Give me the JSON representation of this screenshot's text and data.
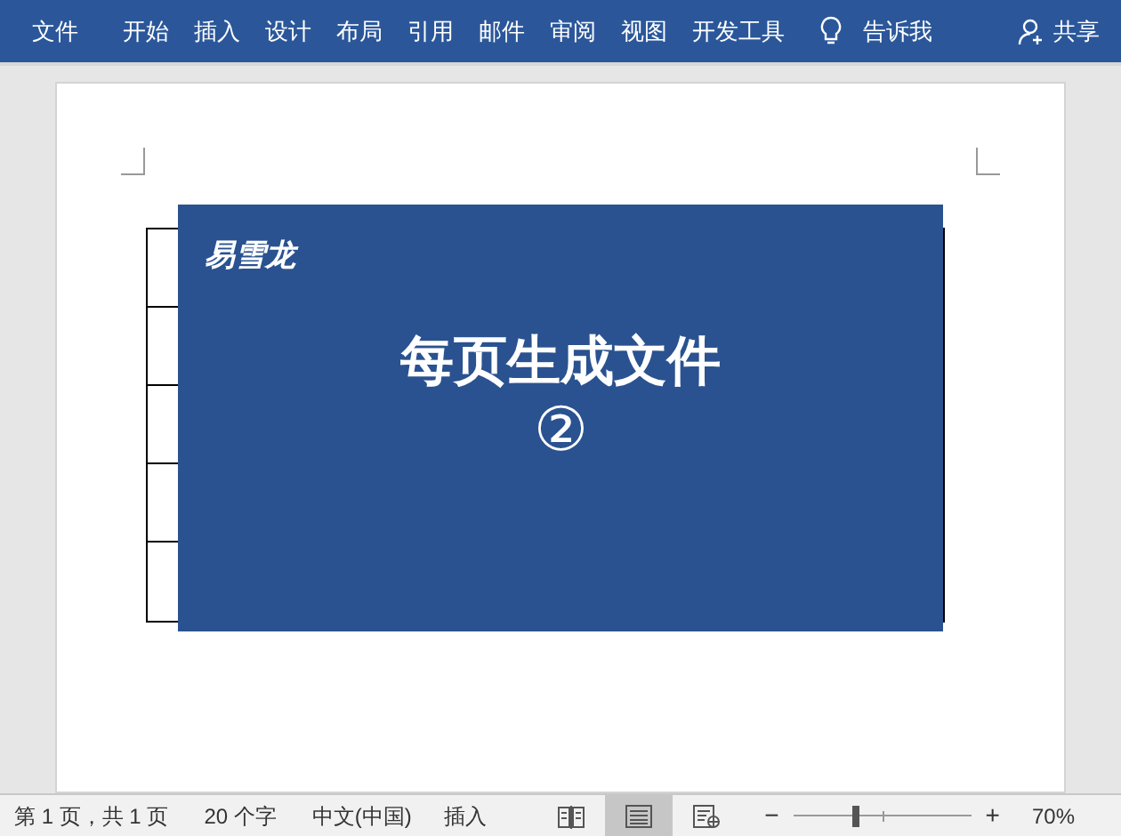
{
  "ribbon": {
    "file_tab": "文件",
    "tabs": [
      {
        "label": "开始"
      },
      {
        "label": "插入"
      },
      {
        "label": "设计"
      },
      {
        "label": "布局"
      },
      {
        "label": "引用"
      },
      {
        "label": "邮件"
      },
      {
        "label": "审阅"
      },
      {
        "label": "视图"
      },
      {
        "label": "开发工具"
      }
    ],
    "tell_me": "告诉我",
    "share": "共享"
  },
  "overlay": {
    "logo": "易雪龙",
    "title": "每页生成文件",
    "number": "②"
  },
  "status_bar": {
    "page": "第 1 页，共 1 页",
    "words": "20 个字",
    "language": "中文(中国)",
    "mode": "插入",
    "views": [
      {
        "kind": "read",
        "selected": false
      },
      {
        "kind": "print",
        "selected": true
      },
      {
        "kind": "web",
        "selected": false
      }
    ],
    "zoom_out": "−",
    "zoom_in": "+",
    "zoom": {
      "level": 0.35
    },
    "zoom_text": "70%"
  }
}
